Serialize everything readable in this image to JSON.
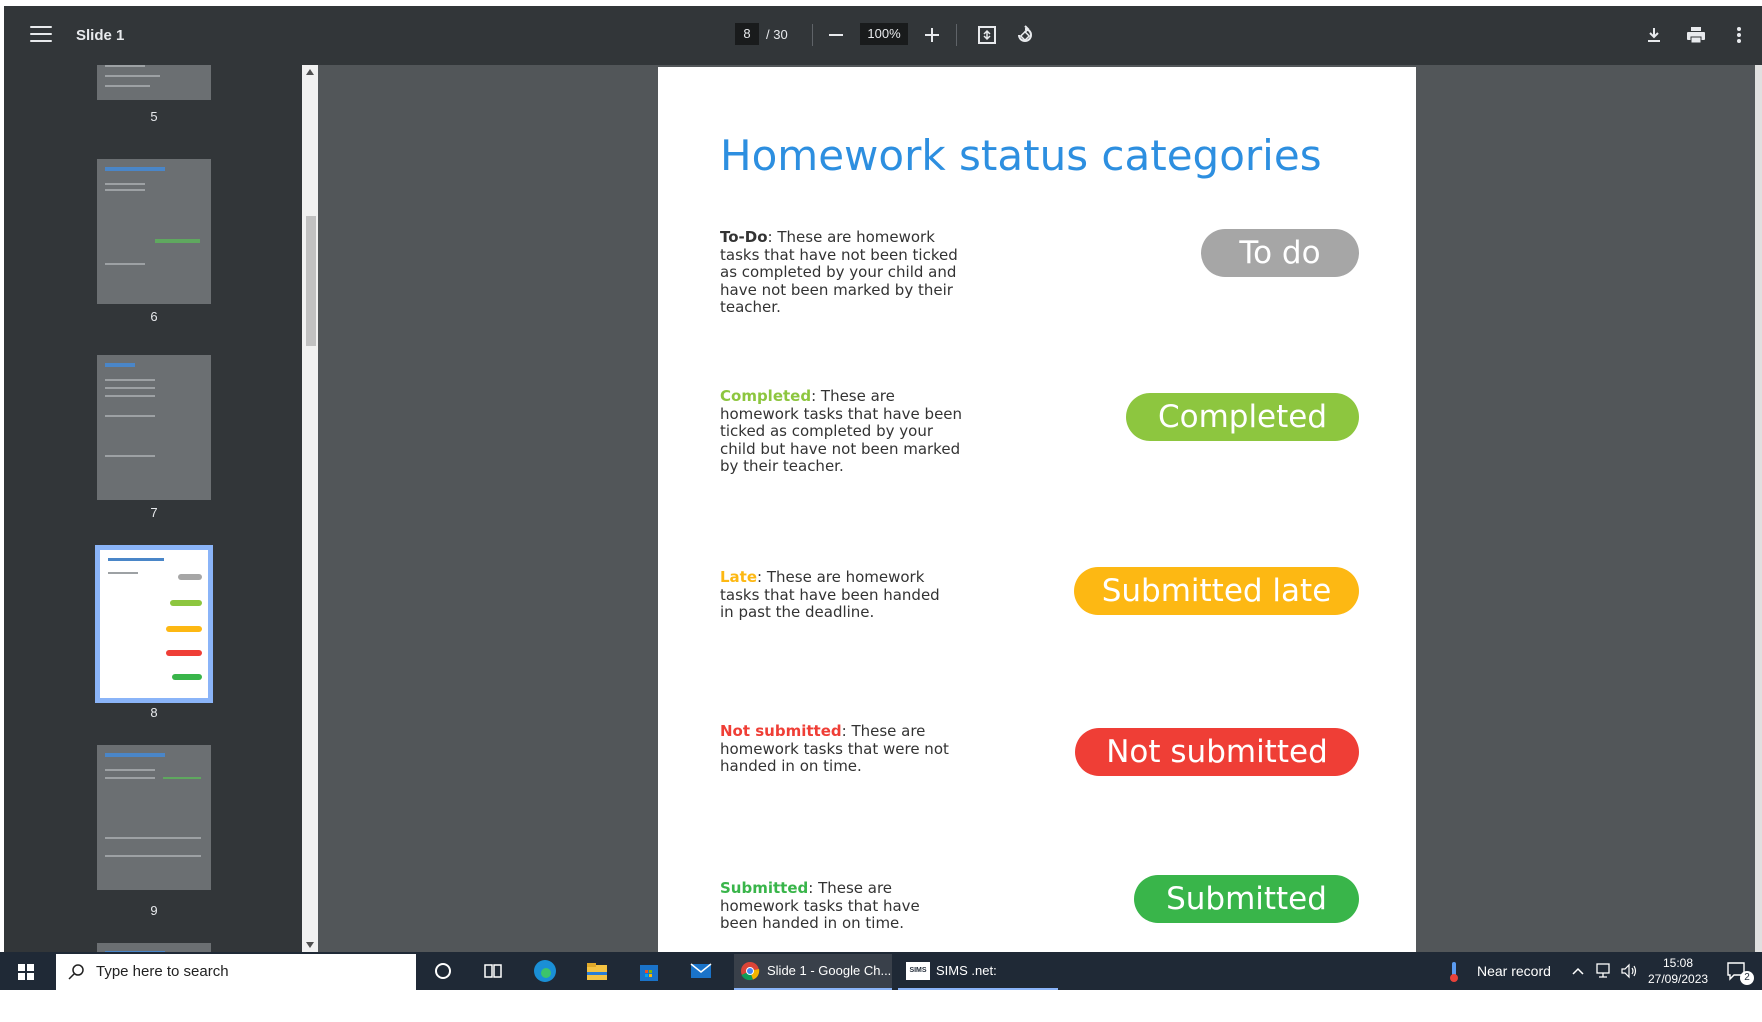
{
  "toolbar": {
    "title": "Slide 1",
    "current_page": "8",
    "page_total": "/ 30",
    "zoom": "100%"
  },
  "sidebar": {
    "thumbnails": [
      {
        "num": "5"
      },
      {
        "num": "6"
      },
      {
        "num": "7"
      },
      {
        "num": "8"
      },
      {
        "num": "9"
      }
    ]
  },
  "page": {
    "title": "Homework status categories",
    "categories": [
      {
        "term": "To-Do",
        "desc": ": These are homework tasks that have not been ticked as completed by your child and have not been marked by their teacher.",
        "pill": "To do",
        "term_color": "#333333",
        "pill_color": "#a6a6a6"
      },
      {
        "term": "Completed",
        "desc": ": These are homework tasks that have been ticked as completed by your child but have not been marked by their teacher.",
        "pill": "Completed",
        "term_color": "#8dc63f",
        "pill_color": "#8dc63f"
      },
      {
        "term": "Late",
        "desc": ": These are homework tasks that have been handed in past the deadline.",
        "pill": "Submitted late",
        "term_color": "#fdb813",
        "pill_color": "#fdb813"
      },
      {
        "term": "Not submitted",
        "desc": ": These are homework tasks that were not handed in on time.",
        "pill": "Not submitted",
        "term_color": "#ef3e36",
        "pill_color": "#ef3e36"
      },
      {
        "term": "Submitted",
        "desc": ": These are homework tasks that have been handed in on time.",
        "pill": "Submitted",
        "term_color": "#39b54a",
        "pill_color": "#39b54a"
      }
    ]
  },
  "taskbar": {
    "search_placeholder": "Type here to search",
    "chrome_label": "Slide 1 - Google Ch...",
    "sims_label": "SIMS .net: CHESSIN...",
    "sims_badge": "SIMS",
    "weather": "Near record",
    "time": "15:08",
    "date": "27/09/2023",
    "notifications": "2"
  }
}
